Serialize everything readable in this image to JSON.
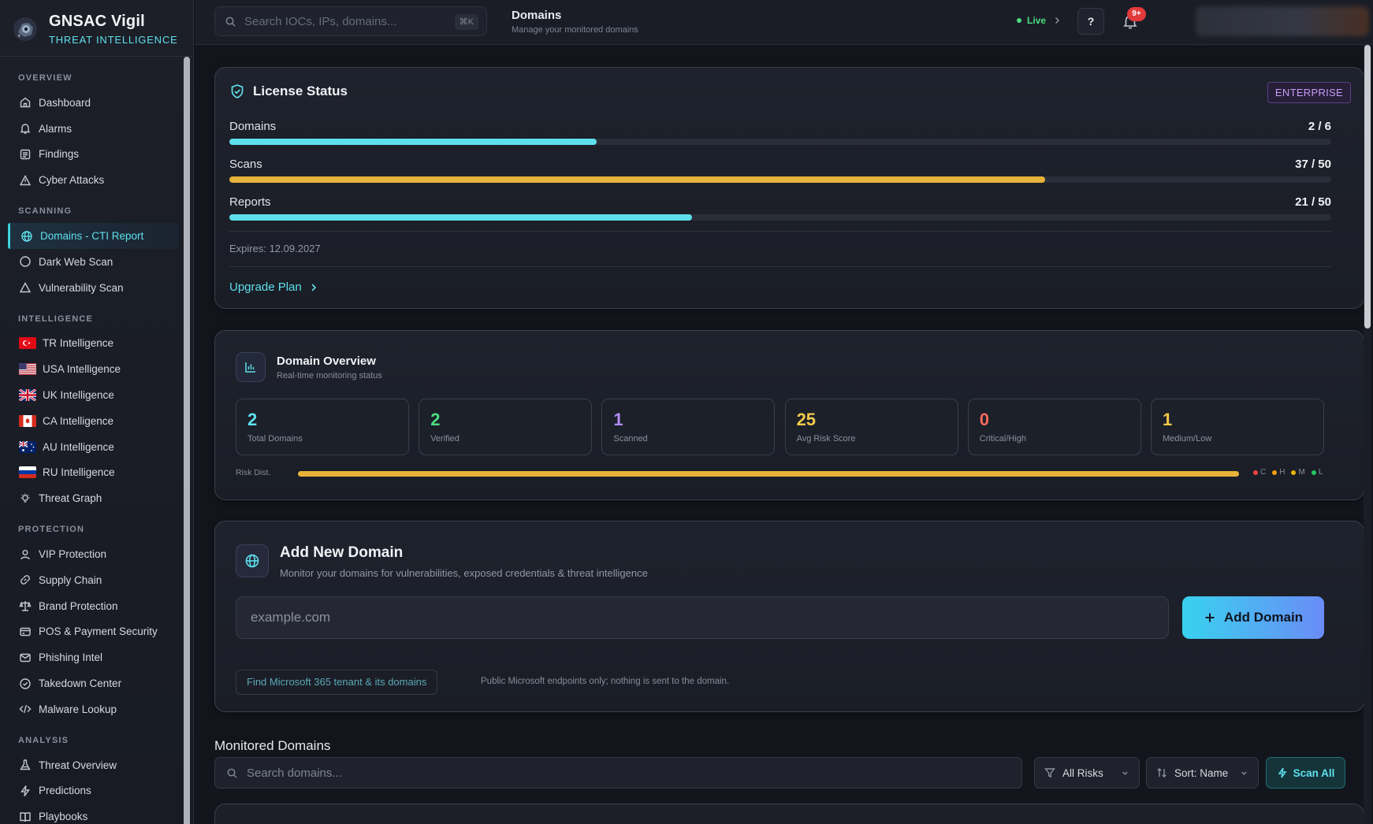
{
  "brand": {
    "name": "GNSAC Vigil",
    "subtitle": "THREAT INTELLIGENCE"
  },
  "sidebar": {
    "sections": [
      {
        "title": "OVERVIEW",
        "items": [
          "Dashboard",
          "Alarms",
          "Findings",
          "Cyber Attacks"
        ]
      },
      {
        "title": "SCANNING",
        "items": [
          "Domains - CTI Report",
          "Dark Web Scan",
          "Vulnerability Scan"
        ]
      },
      {
        "title": "INTELLIGENCE",
        "items": [
          "TR Intelligence",
          "USA Intelligence",
          "UK Intelligence",
          "CA Intelligence",
          "AU Intelligence",
          "RU Intelligence",
          "Threat Graph"
        ]
      },
      {
        "title": "PROTECTION",
        "items": [
          "VIP Protection",
          "Supply Chain",
          "Brand Protection",
          "POS & Payment Security",
          "Phishing Intel",
          "Takedown Center",
          "Malware Lookup"
        ]
      },
      {
        "title": "ANALYSIS",
        "items": [
          "Threat Overview",
          "Predictions",
          "Playbooks"
        ]
      }
    ],
    "active_item": "Domains - CTI Report"
  },
  "topbar": {
    "search_placeholder": "Search IOCs, IPs, domains...",
    "shortcut": "⌘K",
    "page_title": "Domains",
    "page_subtitle": "Manage your monitored domains",
    "live_label": "Live",
    "help_label": "?",
    "notification_count": "9+"
  },
  "license": {
    "title": "License Status",
    "tier": "ENTERPRISE",
    "meters": [
      {
        "label": "Domains",
        "value": "2 / 6",
        "used": 2,
        "limit": 6,
        "color": "#5ee0ec"
      },
      {
        "label": "Scans",
        "value": "37 / 50",
        "used": 37,
        "limit": 50,
        "color": "#e7b23a"
      },
      {
        "label": "Reports",
        "value": "21 / 50",
        "used": 21,
        "limit": 50,
        "color": "#5ee0ec"
      }
    ],
    "expires": "Expires: 12.09.2027",
    "upgrade_label": "Upgrade Plan"
  },
  "overview": {
    "title": "Domain Overview",
    "subtitle": "Real-time monitoring status",
    "stats": [
      {
        "value": "2",
        "label": "Total Domains",
        "color": "#5ee0ec"
      },
      {
        "value": "2",
        "label": "Verified",
        "color": "#4ade80"
      },
      {
        "value": "1",
        "label": "Scanned",
        "color": "#b48cf7"
      },
      {
        "value": "25",
        "label": "Avg Risk Score",
        "color": "#f2c94c"
      },
      {
        "value": "0",
        "label": "Critical/High",
        "color": "#f26b5b"
      },
      {
        "value": "1",
        "label": "Medium/Low",
        "color": "#f2c94c"
      }
    ],
    "risk_label": "Risk Dist.",
    "risk_legend": [
      {
        "key": "C",
        "color": "#ef4444"
      },
      {
        "key": "H",
        "color": "#f59e0b"
      },
      {
        "key": "M",
        "color": "#eab308"
      },
      {
        "key": "L",
        "color": "#22c55e"
      }
    ]
  },
  "add_domain": {
    "title": "Add New Domain",
    "subtitle": "Monitor your domains for vulnerabilities, exposed credentials & threat intelligence",
    "placeholder": "example.com",
    "button_label": "Add Domain",
    "ms_button": "Find Microsoft 365 tenant & its domains",
    "ms_note": "Public Microsoft endpoints only; nothing is sent to the domain."
  },
  "monitored": {
    "title": "Monitored Domains",
    "search_placeholder": "Search domains...",
    "filter_label": "All Risks",
    "sort_label": "Sort: Name",
    "scan_all_label": "Scan All"
  }
}
